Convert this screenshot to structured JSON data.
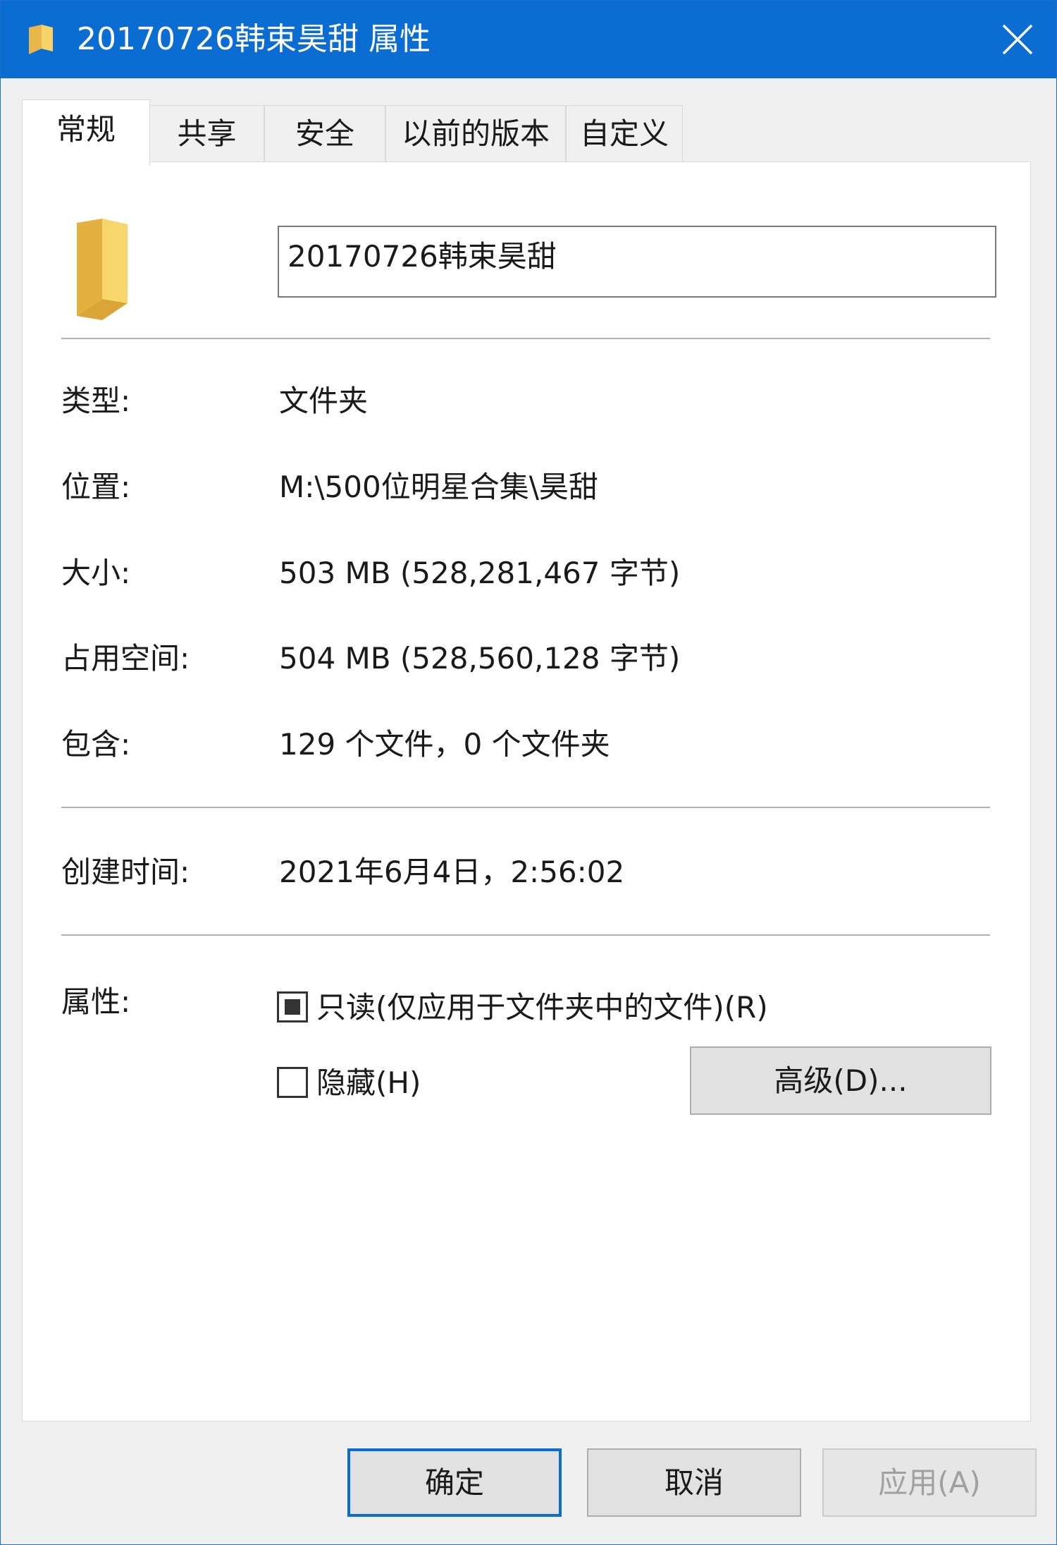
{
  "window": {
    "title": "20170726韩束昊甜 属性",
    "title_icon": "folder-icon",
    "close_icon": "close-icon",
    "accent_color": "#0b6cd1"
  },
  "tabs": [
    {
      "label": "常规",
      "active": true
    },
    {
      "label": "共享",
      "active": false
    },
    {
      "label": "安全",
      "active": false
    },
    {
      "label": "以前的版本",
      "active": false
    },
    {
      "label": "自定义",
      "active": false
    }
  ],
  "general": {
    "folder_icon": "folder-icon",
    "name_value": "20170726韩束昊甜",
    "type": {
      "label": "类型:",
      "value": "文件夹"
    },
    "location": {
      "label": "位置:",
      "value": "M:\\500位明星合集\\昊甜"
    },
    "size": {
      "label": "大小:",
      "value": "503 MB (528,281,467 字节)"
    },
    "size_on_disk": {
      "label": "占用空间:",
      "value": "504 MB (528,560,128 字节)"
    },
    "contains": {
      "label": "包含:",
      "value": "129 个文件，0 个文件夹"
    },
    "created": {
      "label": "创建时间:",
      "value": "2021年6月4日，2:56:02"
    },
    "attributes": {
      "label": "属性:",
      "readonly": {
        "label": "只读(仅应用于文件夹中的文件)(R)",
        "state": "indeterminate"
      },
      "hidden": {
        "label": "隐藏(H)",
        "state": "unchecked"
      },
      "advanced_button": "高级(D)..."
    }
  },
  "footer": {
    "ok": "确定",
    "cancel": "取消",
    "apply": "应用(A)",
    "apply_enabled": false
  }
}
